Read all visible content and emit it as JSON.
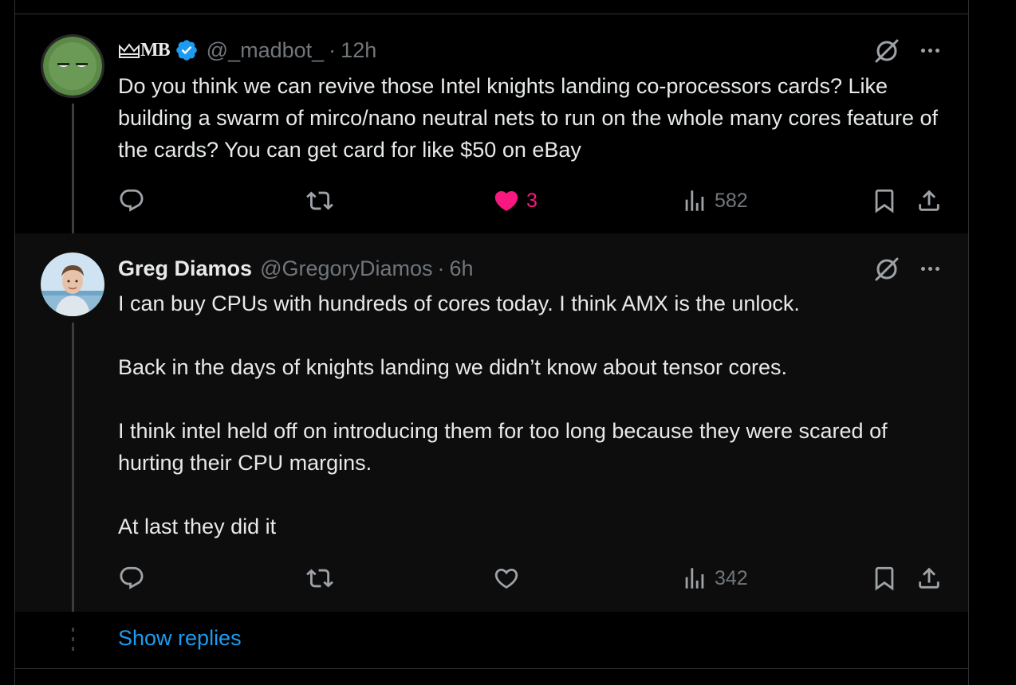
{
  "tweets": [
    {
      "display_name": "MB",
      "handle": "@_madbot_",
      "separator": "·",
      "time": "12h",
      "verified": true,
      "body": [
        "Do you think we can revive those Intel knights landing co-processors cards? Like building a swarm of mirco/nano neutral nets to run on the whole many cores feature of the cards? You can get card for like $50 on eBay"
      ],
      "stats": {
        "replies": "",
        "retweets": "",
        "likes": "3",
        "liked": true,
        "views": "582"
      }
    },
    {
      "display_name": "Greg Diamos",
      "handle": "@GregoryDiamos",
      "separator": "·",
      "time": "6h",
      "verified": false,
      "body": [
        "I can buy CPUs with hundreds of cores today. I think AMX is the unlock.",
        "Back in the days of knights landing we didn’t know about tensor cores.",
        "I think intel held off on introducing them for too long because they were scared of hurting their CPU margins.",
        "At last they did it"
      ],
      "stats": {
        "replies": "",
        "retweets": "",
        "likes": "",
        "liked": false,
        "views": "342"
      }
    }
  ],
  "show_replies_label": "Show replies",
  "colors": {
    "background": "#000000",
    "text": "#e7e9ea",
    "muted": "#71767b",
    "accent": "#1d9bf0",
    "like": "#f91880"
  },
  "icons": [
    "reply-icon",
    "retweet-icon",
    "heart-icon",
    "views-icon",
    "bookmark-icon",
    "share-icon",
    "grok-icon",
    "more-icon",
    "verified-icon"
  ]
}
